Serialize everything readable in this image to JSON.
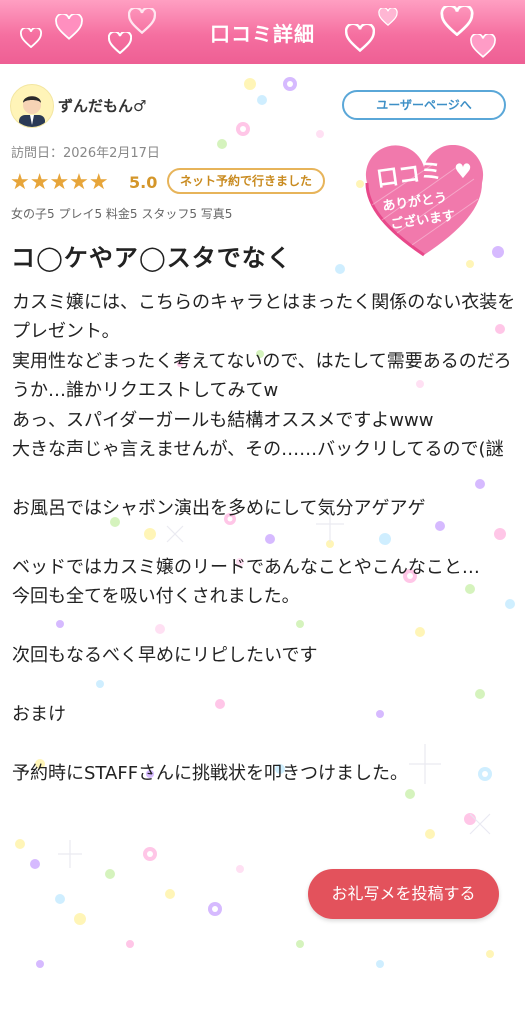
{
  "header": {
    "title": "口コミ詳細"
  },
  "user": {
    "name": "ずんだもん♂",
    "user_page_button": "ユーザーページへ",
    "avatar_icon": "avatar-man-icon"
  },
  "review": {
    "visit_date": "訪問日：2026年2月17日",
    "stars": "★★★★★",
    "rating": "5.0",
    "net_badge": "ネット予約で行きました",
    "sub_ratings": "女の子5 プレイ5 料金5 スタッフ5 写真5",
    "title": "コ◯ケやア◯スタでなく",
    "body": "カスミ嬢には、こちらのキャラとはまったく関係のない衣装をプレゼント。\n実用性などまったく考えてないので、はたして需要あるのだろうか…誰かリクエストしてみてw\nあっ、スパイダーガールも結構オススメですよwww\n大きな声じゃ言えませんが、その……バックリしてるので(謎\n\nお風呂ではシャボン演出を多めにして気分アゲアゲ\n\nベッドではカスミ嬢のリードであんなことやこんなこと…\n今回も全てを吸い付くされました。\n\n次回もなるべく早めにリピしたいです\n\nおまけ\n\n予約時にSTAFFさんに挑戦状を叩きつけました。"
  },
  "stamp": {
    "line1": "口コミ",
    "line2": "ありがとう",
    "line3": "ございます"
  },
  "post_button": {
    "label": "お礼写メを投稿する"
  },
  "colors": {
    "header_pink": "#f56fa0",
    "star_gold": "#e7a53a",
    "user_btn_blue": "#5aa7d8",
    "post_btn_red": "#e3525c",
    "stamp_pink": "#e8488a"
  }
}
